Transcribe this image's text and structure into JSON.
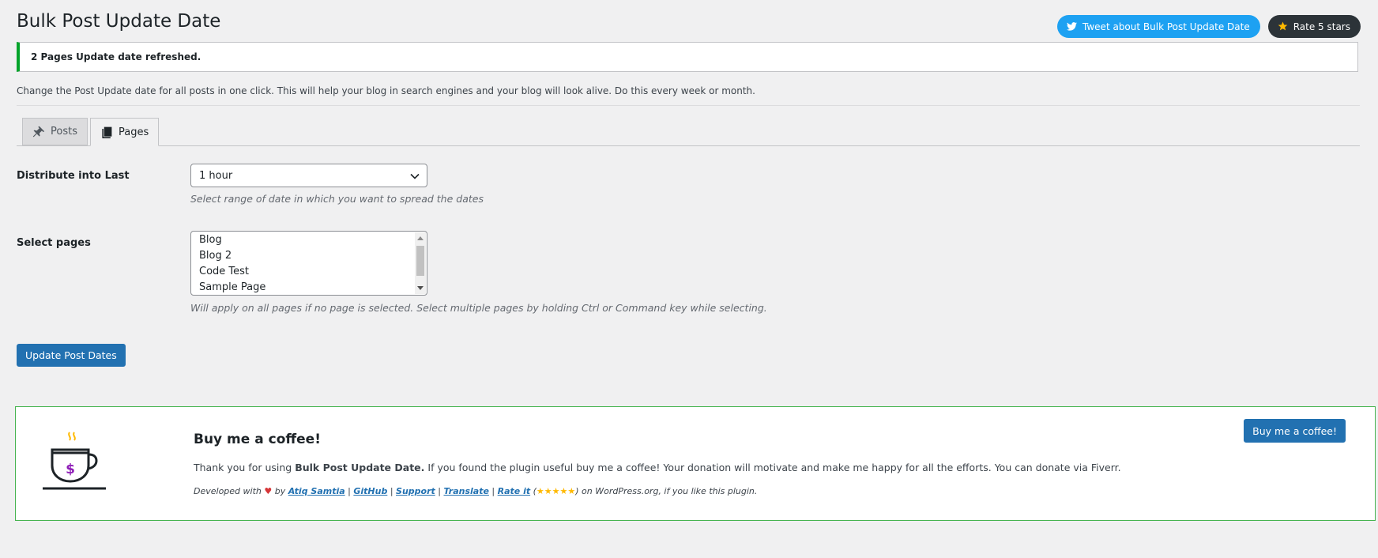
{
  "header": {
    "title": "Bulk Post Update Date",
    "tweet_label": "Tweet about Bulk Post Update Date",
    "rate_label": "Rate 5 stars"
  },
  "notice": {
    "text": "2 Pages Update date refreshed."
  },
  "description": "Change the Post Update date for all posts in one click. This will help your blog in search engines and your blog will look alive. Do this every week or month.",
  "tabs": [
    {
      "label": "Posts",
      "icon": "pin-icon",
      "active": false
    },
    {
      "label": "Pages",
      "icon": "pages-icon",
      "active": true
    }
  ],
  "form": {
    "distribute_label": "Distribute into Last",
    "distribute_value": "1 hour",
    "distribute_help": "Select range of date in which you want to spread the dates",
    "pages_label": "Select pages",
    "pages_options": [
      "Blog",
      "Blog 2",
      "Code Test",
      "Sample Page"
    ],
    "pages_help": "Will apply on all pages if no page is selected. Select multiple pages by holding Ctrl or Command key while selecting.",
    "submit_label": "Update Post Dates"
  },
  "coffee": {
    "title": "Buy me a coffee!",
    "text_pre": "Thank you for using ",
    "text_strong": "Bulk Post Update Date.",
    "text_post": " If you found the plugin useful buy me a coffee! Your donation will motivate and make me happy for all the efforts. You can donate via Fiverr.",
    "dev_pre": "Developed with",
    "dev_by": "by",
    "author": "Atiq Samtia",
    "github": "GitHub",
    "support": "Support",
    "translate": "Translate",
    "rate": "Rate it",
    "stars": "★★★★★",
    "dev_post": "on WordPress.org, if you like this plugin.",
    "button_label": "Buy me a coffee!"
  },
  "colors": {
    "primary": "#2271b1",
    "twitter": "#1da1f2",
    "notice_success": "#00a32a",
    "coffee_border": "#46b450",
    "star": "#ffb900",
    "dollar": "#8e1eb7"
  }
}
